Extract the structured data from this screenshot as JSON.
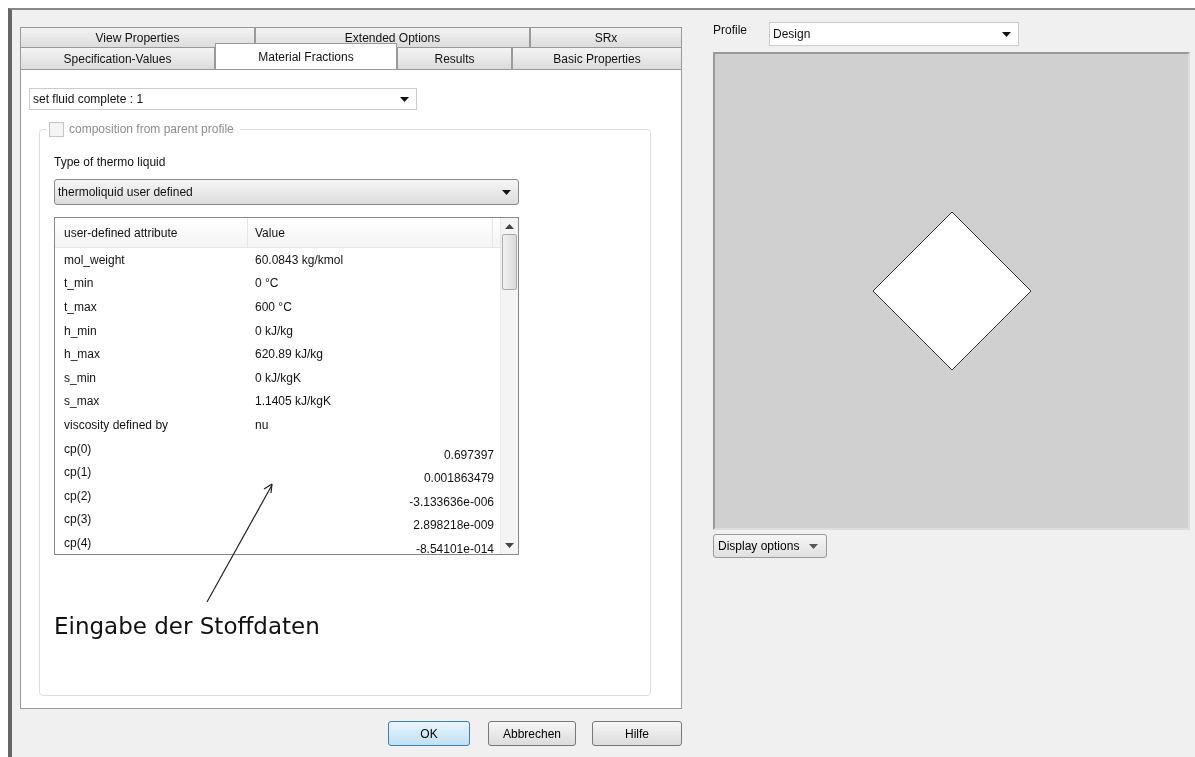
{
  "tabs_top": [
    {
      "label": "View Properties",
      "selected": false
    },
    {
      "label": "Extended Options",
      "selected": false
    },
    {
      "label": "SRx",
      "selected": false
    }
  ],
  "tabs_bottom": [
    {
      "label": "Specification-Values",
      "selected": false
    },
    {
      "label": "Material Fractions",
      "selected": true
    },
    {
      "label": "Results",
      "selected": false
    },
    {
      "label": "Basic Properties",
      "selected": false
    }
  ],
  "set_dropdown": {
    "value": "set fluid complete : 1"
  },
  "parent_checkbox": {
    "label": "composition from parent profile",
    "checked": false,
    "disabled": true
  },
  "thermo": {
    "label": "Type of thermo liquid",
    "value": "thermoliquid user defined"
  },
  "table": {
    "columns": [
      "user-defined attribute",
      "Value"
    ],
    "rows": [
      {
        "attribute": "mol_weight",
        "value": "60.0843 kg/kmol",
        "kind": "text"
      },
      {
        "attribute": "t_min",
        "value": "0 °C",
        "kind": "text"
      },
      {
        "attribute": "t_max",
        "value": "600 °C",
        "kind": "text"
      },
      {
        "attribute": "h_min",
        "value": "0 kJ/kg",
        "kind": "text"
      },
      {
        "attribute": "h_max",
        "value": "620.89 kJ/kg",
        "kind": "text"
      },
      {
        "attribute": "s_min",
        "value": "0 kJ/kgK",
        "kind": "text"
      },
      {
        "attribute": "s_max",
        "value": "1.1405 kJ/kgK",
        "kind": "text"
      },
      {
        "attribute": "viscosity defined by",
        "value": "nu",
        "kind": "text"
      },
      {
        "attribute": "cp(0)",
        "value": "0.697397",
        "kind": "number"
      },
      {
        "attribute": "cp(1)",
        "value": "0.001863479",
        "kind": "number"
      },
      {
        "attribute": "cp(2)",
        "value": "-3.133636e-006",
        "kind": "number"
      },
      {
        "attribute": "cp(3)",
        "value": "2.898218e-009",
        "kind": "number"
      },
      {
        "attribute": "cp(4)",
        "value": "-8.54101e-014",
        "kind": "number"
      }
    ]
  },
  "annotation": "Eingabe der Stoffdaten",
  "buttons": [
    {
      "label": "OK",
      "default": true
    },
    {
      "label": "Abbrechen",
      "default": false
    },
    {
      "label": "Hilfe",
      "default": false
    }
  ],
  "profile": {
    "label": "Profile",
    "value": "Design"
  },
  "display_options": "Display options"
}
